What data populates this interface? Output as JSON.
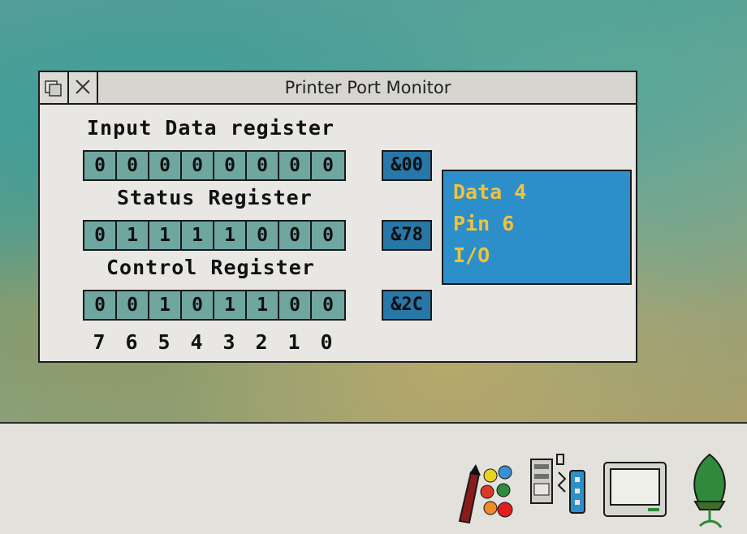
{
  "window": {
    "title": "Printer Port Monitor"
  },
  "registers": [
    {
      "name": "Input Data register",
      "bits": [
        "0",
        "0",
        "0",
        "0",
        "0",
        "0",
        "0",
        "0"
      ],
      "hex": "&00"
    },
    {
      "name": "Status Register",
      "bits": [
        "0",
        "1",
        "1",
        "1",
        "1",
        "0",
        "0",
        "0"
      ],
      "hex": "&78"
    },
    {
      "name": "Control Register",
      "bits": [
        "0",
        "0",
        "1",
        "0",
        "1",
        "1",
        "0",
        "0"
      ],
      "hex": "&2C"
    }
  ],
  "bit_numbers": [
    "7",
    "6",
    "5",
    "4",
    "3",
    "2",
    "1",
    "0"
  ],
  "info_box": {
    "line1": "Data 4",
    "line2": "Pin 6",
    "line3": "I/O"
  },
  "iconbar": {
    "icons": [
      "palette-icon",
      "printer-port-icon",
      "display-icon",
      "acorn-icon"
    ]
  },
  "colors": {
    "bit_cell": "#6fa6a0",
    "hex_badge": "#2777a9",
    "info_bg": "#2d8fc9",
    "info_text": "#f2c23a"
  }
}
